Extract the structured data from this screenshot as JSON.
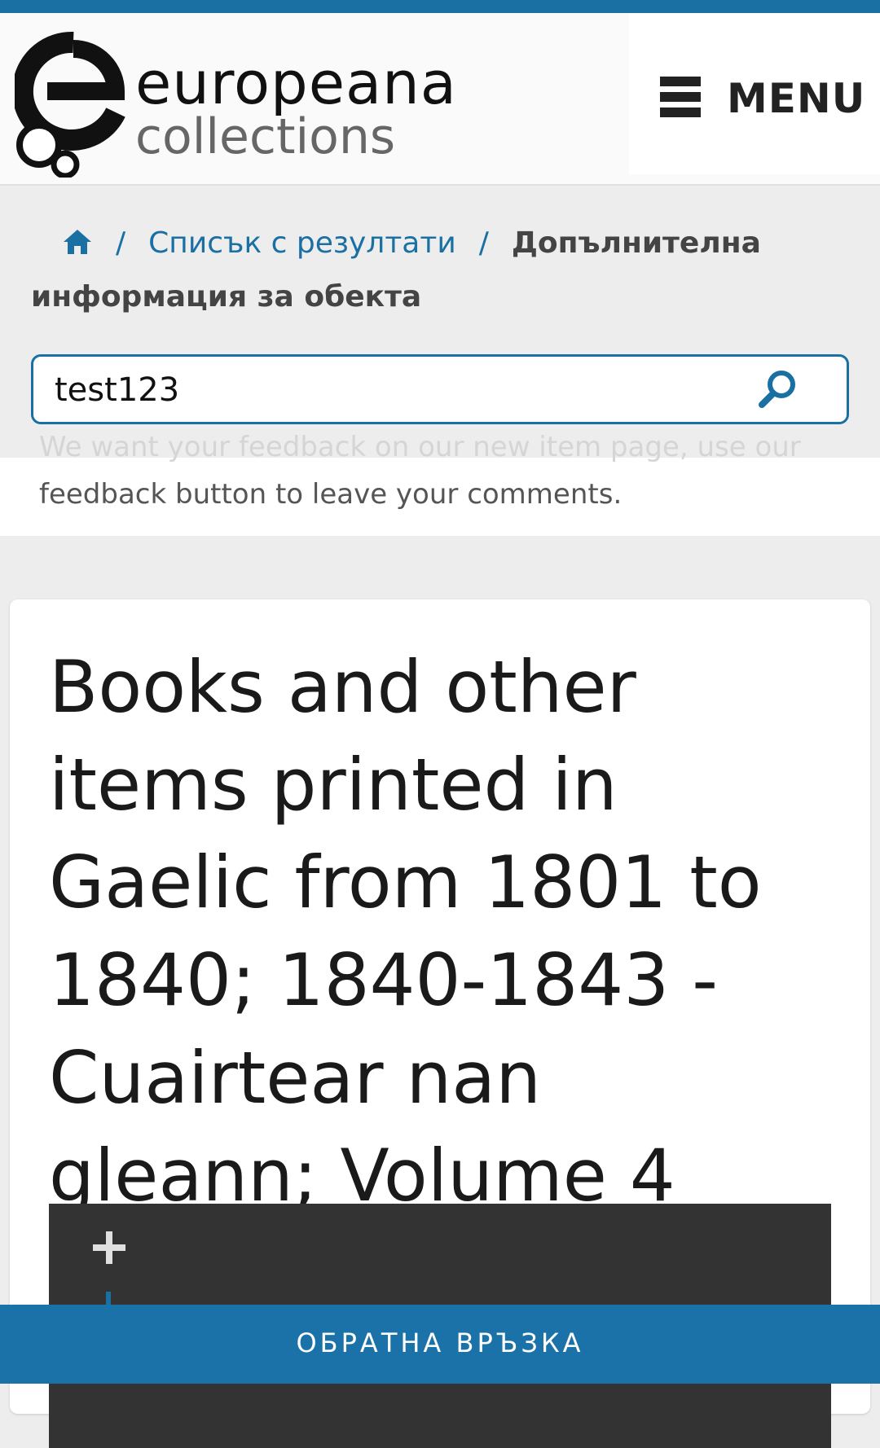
{
  "header": {
    "logo_line1": "europeana",
    "logo_line2": "collections",
    "menu_label": "MENU"
  },
  "breadcrumb": {
    "home_icon": "home-icon",
    "results_label": "Списък с резултати",
    "current_label": "Допълнителна информация за обекта",
    "separator": "/"
  },
  "search": {
    "value": "test123",
    "icon": "search-icon"
  },
  "feedback_note": {
    "faded_text": "We want your feedback on our new item page, use our",
    "text": "feedback button to leave your comments."
  },
  "item": {
    "title": "Books and other items printed in Gaelic from 1801 to 1840; 1840-1843 - Cuairtear nan gleann; Volume 4"
  },
  "viewer": {
    "zoom_in_icon": "plus-icon",
    "zoom_out_icon": "minus-icon"
  },
  "feedback_button": {
    "label": "ОБРАТНА ВРЪЗКА"
  },
  "colors": {
    "accent": "#1a6fa3",
    "viewer_bg": "#333333",
    "page_bg": "#ededed"
  }
}
